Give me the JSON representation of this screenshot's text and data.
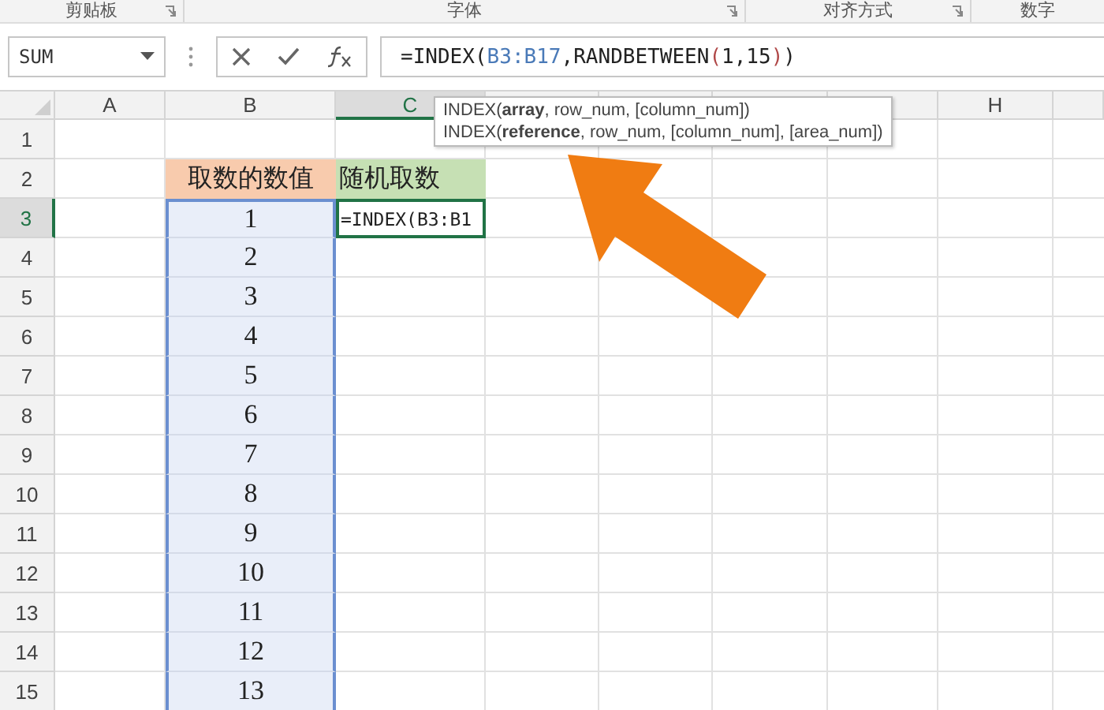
{
  "ribbon_groups": [
    {
      "label": "剪贴板",
      "launcher": true
    },
    {
      "label": "字体",
      "launcher": true
    },
    {
      "label": "对齐方式",
      "launcher": true
    },
    {
      "label": "数字",
      "launcher": false
    }
  ],
  "name_box": {
    "value": "SUM"
  },
  "formula_bar": {
    "segments": [
      {
        "text": "=INDEX(",
        "kind": "plain"
      },
      {
        "text": "B3:B17",
        "kind": "reference"
      },
      {
        "text": ",RANDBETWEEN",
        "kind": "plain"
      },
      {
        "text": "(",
        "kind": "paren"
      },
      {
        "text": "1,15",
        "kind": "plain"
      },
      {
        "text": ")",
        "kind": "paren"
      },
      {
        "text": ")",
        "kind": "plain"
      }
    ]
  },
  "columns": [
    {
      "label": "A",
      "selected": false
    },
    {
      "label": "B",
      "selected": false
    },
    {
      "label": "C",
      "selected": true
    },
    {
      "label": "H",
      "selected": false
    }
  ],
  "tooltip": {
    "lines": [
      "INDEX(**array**, row_num, [column_num])",
      "INDEX(**reference**, row_num, [column_num], [area_num])"
    ]
  },
  "rows": [
    {
      "number": "1",
      "selected": false,
      "kind": "empty"
    },
    {
      "number": "2",
      "selected": false,
      "kind": "header",
      "column_b": "取数的数值",
      "column_c": "随机取数"
    },
    {
      "number": "3",
      "selected": true,
      "kind": "data",
      "column_b": "1",
      "column_c": "=INDEX(B3:B1"
    },
    {
      "number": "4",
      "selected": false,
      "kind": "data",
      "column_b": "2"
    },
    {
      "number": "5",
      "selected": false,
      "kind": "data",
      "column_b": "3"
    },
    {
      "number": "6",
      "selected": false,
      "kind": "data",
      "column_b": "4"
    },
    {
      "number": "7",
      "selected": false,
      "kind": "data",
      "column_b": "5"
    },
    {
      "number": "8",
      "selected": false,
      "kind": "data",
      "column_b": "6"
    },
    {
      "number": "9",
      "selected": false,
      "kind": "data",
      "column_b": "7"
    },
    {
      "number": "10",
      "selected": false,
      "kind": "data",
      "column_b": "8"
    },
    {
      "number": "11",
      "selected": false,
      "kind": "data",
      "column_b": "9"
    },
    {
      "number": "12",
      "selected": false,
      "kind": "data",
      "column_b": "10"
    },
    {
      "number": "13",
      "selected": false,
      "kind": "data",
      "column_b": "11"
    },
    {
      "number": "14",
      "selected": false,
      "kind": "data",
      "column_b": "12"
    },
    {
      "number": "15",
      "selected": false,
      "kind": "data",
      "column_b": "13"
    }
  ]
}
